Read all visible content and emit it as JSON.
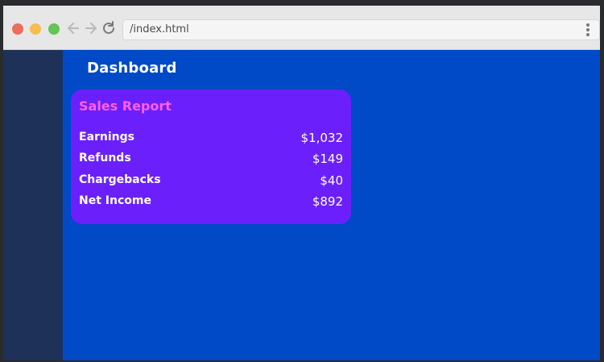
{
  "browser": {
    "address": "/index.html",
    "icons": {
      "back": "arrow-left-icon",
      "forward": "arrow-right-icon",
      "reload": "reload-icon",
      "menu": "kebab-menu-icon"
    }
  },
  "page": {
    "title": "Dashboard"
  },
  "sales_report": {
    "title": "Sales Report",
    "rows": [
      {
        "label": "Earnings",
        "value": "$1,032"
      },
      {
        "label": "Refunds",
        "value": "$149"
      },
      {
        "label": "Chargebacks",
        "value": "$40"
      },
      {
        "label": "Net Income",
        "value": "$892"
      }
    ]
  },
  "colors": {
    "content_bg": "#0049c7",
    "sidebar_bg": "#1e3158",
    "card_bg": "#6b20fb",
    "card_title": "#ff5fe8"
  }
}
